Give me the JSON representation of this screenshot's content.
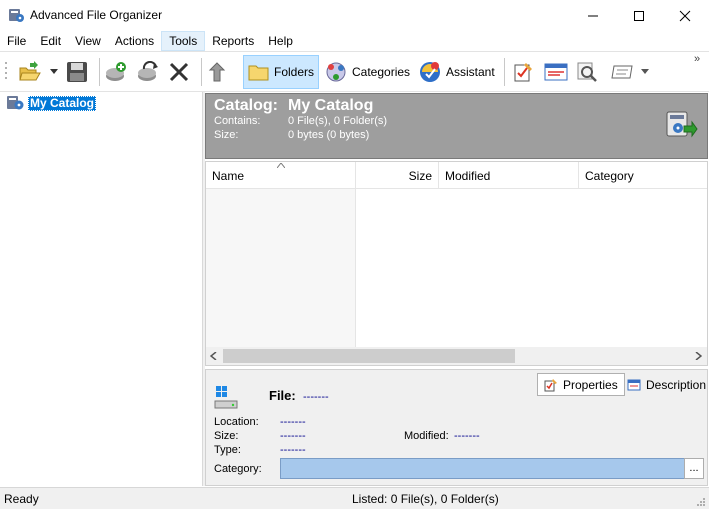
{
  "window": {
    "title": "Advanced File Organizer"
  },
  "menu": [
    "File",
    "Edit",
    "View",
    "Actions",
    "Tools",
    "Reports",
    "Help"
  ],
  "toolbar": {
    "folders": "Folders",
    "categories": "Categories",
    "assistant": "Assistant",
    "overflow": "»"
  },
  "tree": {
    "root_label": "My Catalog"
  },
  "catalog": {
    "label": "Catalog:",
    "name": "My Catalog",
    "contains_label": "Contains:",
    "contains_value": "0 File(s), 0 Folder(s)",
    "size_label": "Size:",
    "size_value": "0 bytes (0 bytes)"
  },
  "list": {
    "columns": [
      "Name",
      "Size",
      "Modified",
      "Category"
    ]
  },
  "file_panel": {
    "tabs": {
      "properties": "Properties",
      "description": "Description"
    },
    "file_label": "File:",
    "file_value": "-------",
    "location_label": "Location:",
    "location_value": "-------",
    "size_label": "Size:",
    "size_value": "-------",
    "modified_label": "Modified:",
    "modified_value": "-------",
    "type_label": "Type:",
    "type_value": "-------",
    "category_label": "Category:",
    "category_value": "",
    "browse": "..."
  },
  "status": {
    "left": "Ready",
    "center": "Listed: 0 File(s), 0 Folder(s)"
  },
  "colors": {
    "accent": "#0078d7",
    "header_gray": "#9e9e9e",
    "selection": "#a6c8ec"
  }
}
